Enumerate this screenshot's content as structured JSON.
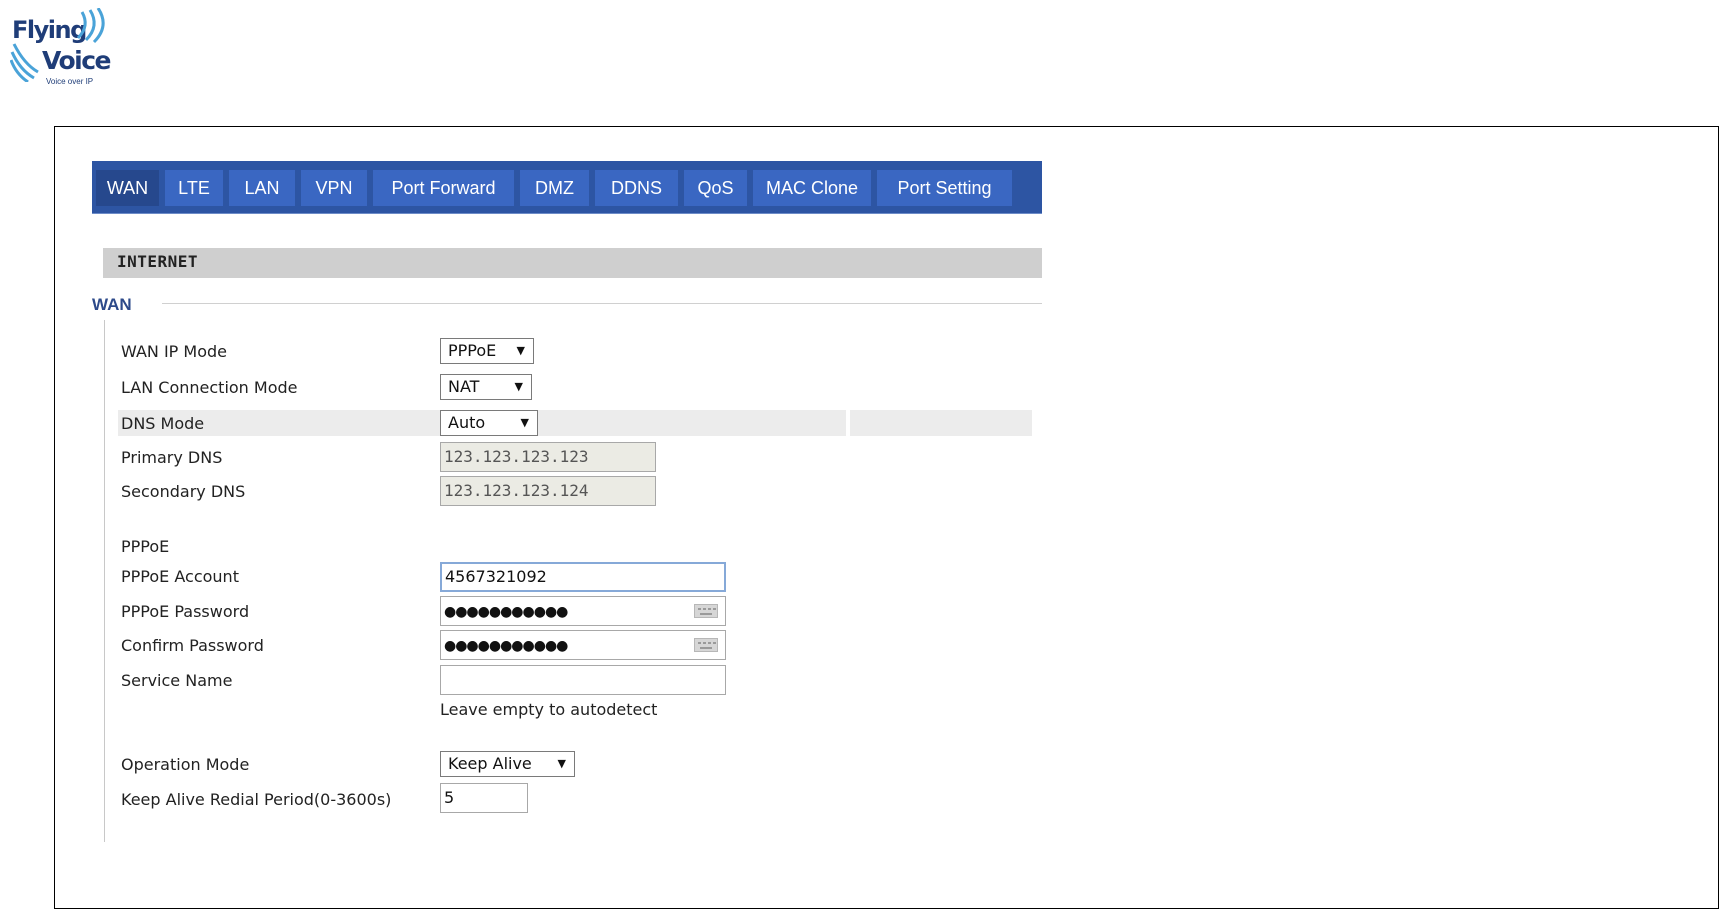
{
  "logo": {
    "line1": "Flying",
    "line2": "Voice",
    "tagline": "Voice over IP"
  },
  "tabs": [
    {
      "label": "WAN",
      "active": true
    },
    {
      "label": "LTE"
    },
    {
      "label": "LAN"
    },
    {
      "label": "VPN"
    },
    {
      "label": "Port Forward"
    },
    {
      "label": "DMZ"
    },
    {
      "label": "DDNS"
    },
    {
      "label": "QoS"
    },
    {
      "label": "MAC Clone"
    },
    {
      "label": "Port Setting"
    }
  ],
  "section": {
    "title": "INTERNET"
  },
  "fieldset": {
    "legend": "WAN"
  },
  "form": {
    "wan_ip_mode": {
      "label": "WAN IP Mode",
      "value": "PPPoE"
    },
    "lan_connection_mode": {
      "label": "LAN Connection Mode",
      "value": "NAT"
    },
    "dns_mode": {
      "label": "DNS Mode",
      "value": "Auto"
    },
    "primary_dns": {
      "label": "Primary DNS",
      "value": "123.123.123.123"
    },
    "secondary_dns": {
      "label": "Secondary DNS",
      "value": "123.123.123.124"
    },
    "pppoe_heading": "PPPoE",
    "pppoe_account": {
      "label": "PPPoE Account",
      "value": "4567321092"
    },
    "pppoe_password": {
      "label": "PPPoE Password",
      "value": "●●●●●●●●●●●"
    },
    "confirm_password": {
      "label": "Confirm Password",
      "value": "●●●●●●●●●●●"
    },
    "service_name": {
      "label": "Service Name",
      "value": "",
      "hint": "Leave empty to autodetect"
    },
    "operation_mode": {
      "label": "Operation Mode",
      "value": "Keep Alive"
    },
    "keep_alive_period": {
      "label": "Keep Alive Redial Period(0-3600s)",
      "value": "5"
    }
  },
  "colors": {
    "tabbar": "#2d55a3",
    "tab": "#3a67c2",
    "tab_active": "#26488d",
    "legend": "#2d4a8a",
    "logo": "#1f3d78"
  },
  "icons": {
    "password_keyboard": "keyboard-icon",
    "dropdown": "triangle-down-icon"
  }
}
